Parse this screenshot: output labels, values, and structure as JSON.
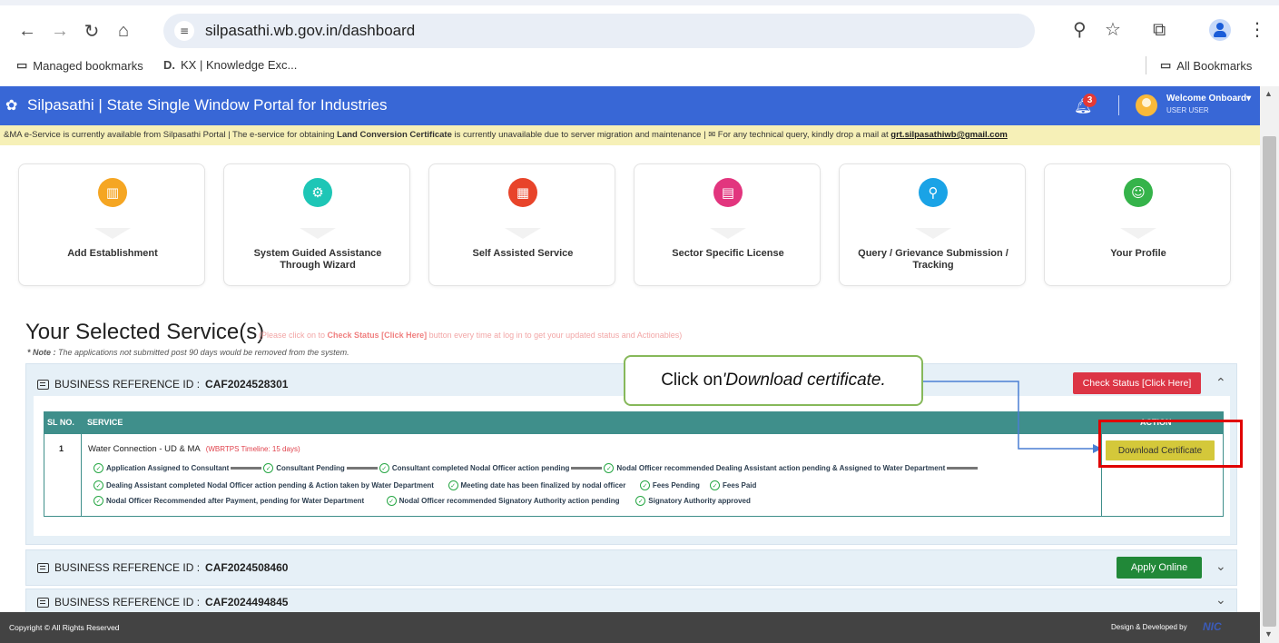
{
  "browser": {
    "url": "silpasathi.wb.gov.in/dashboard",
    "bookmarks": [
      {
        "icon": "managed-bookmarks-icon",
        "label": "Managed bookmarks"
      },
      {
        "icon": "kx-icon",
        "label": "KX | Knowledge Exc..."
      }
    ],
    "all_bookmarks": "All Bookmarks"
  },
  "header": {
    "title": "Silpasathi | State Single Window Portal for Industries",
    "notification_count": "3",
    "welcome": "Welcome Onboard",
    "user": "USER USER",
    "color": "#3867d6"
  },
  "marquee": {
    "prefix": "&MA e-Service is currently available from Silpasathi Portal | The e-service for obtaining ",
    "bold": "Land Conversion Certificate",
    "middle": " is currently unavailable due to server migration and maintenance | ",
    "query": " For any technical query, kindly drop a mail at ",
    "email": "grt.silpasathiwb@gmail.com"
  },
  "cards": [
    {
      "label": "Add Establishment",
      "icon": "building-icon",
      "color": "#f5a623"
    },
    {
      "label": "System Guided Assistance Through Wizard",
      "icon": "gear-icon",
      "color": "#1ec6b6"
    },
    {
      "label": "Self Assisted Service",
      "icon": "grid-icon",
      "color": "#e8442a"
    },
    {
      "label": "Sector Specific License",
      "icon": "license-icon",
      "color": "#e2357e"
    },
    {
      "label": "Query / Grievance Submission / Tracking",
      "icon": "search-icon",
      "color": "#1aa3e6"
    },
    {
      "label": "Your Profile",
      "icon": "profile-icon",
      "color": "#35b34a"
    }
  ],
  "selected": {
    "title": "Your Selected Service(s)",
    "hint_pre": "(Please click on to ",
    "hint_bold": "Check Status [Click Here]",
    "hint_post": " button every time at log in to get your updated status and Actionables)",
    "note_label": "* Note :",
    "note_text": " The applications not submitted post 90 days would be removed from the system."
  },
  "businesses": [
    {
      "label": "BUSINESS REFERENCE ID :",
      "id": "CAF2024528301",
      "button": "Check Status [Click Here]",
      "chevron": "^"
    },
    {
      "label": "BUSINESS REFERENCE ID :",
      "id": "CAF2024508460",
      "button": "Apply Online",
      "chevron": "v"
    },
    {
      "label": "BUSINESS REFERENCE ID :",
      "id": "CAF2024494845",
      "button": "",
      "chevron": "v"
    }
  ],
  "table": {
    "headers": {
      "sl": "SL NO.",
      "service": "SERVICE",
      "action": "ACTION"
    },
    "row": {
      "sl": "1",
      "service": "Water Connection - UD & MA",
      "timeline": "(WBRTPS Timeline: 15 days)",
      "steps_line1": [
        "Application Assigned to Consultant",
        "Consultant Pending",
        "Consultant completed Nodal Officer action pending",
        "Nodal Officer recommended Dealing Assistant action pending & Assigned to Water Department"
      ],
      "steps_line2": [
        "Dealing Assistant completed Nodal Officer action pending & Action taken by Water Department",
        "Meeting date has been finalized by nodal officer",
        "Fees Pending",
        "Fees Paid"
      ],
      "steps_line3": [
        "Nodal Officer Recommended after Payment, pending for Water Department",
        "Nodal Officer recommended Signatory Authority action pending",
        "Signatory Authority approved"
      ],
      "action": "Download Certificate"
    }
  },
  "annotation": {
    "prefix": "Click on ",
    "emphasis": "'Download certificate."
  },
  "footer": {
    "left": "Copyright © All Rights Reserved",
    "right": "Design & Developed by",
    "logo": "NIC"
  }
}
